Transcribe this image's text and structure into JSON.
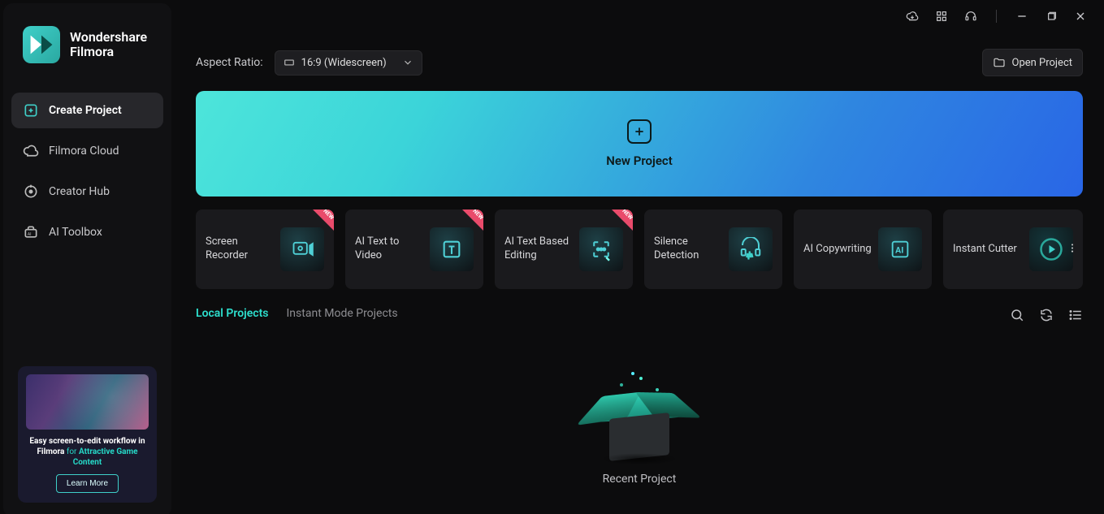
{
  "brand": {
    "line1": "Wondershare",
    "line2": "Filmora"
  },
  "sidebar": {
    "items": [
      {
        "label": "Create Project"
      },
      {
        "label": "Filmora Cloud"
      },
      {
        "label": "Creator Hub"
      },
      {
        "label": "AI Toolbox"
      }
    ]
  },
  "promo": {
    "brand": "Wondershare Filmora",
    "text_prefix": "Easy screen-to-edit workflow in Filmora ",
    "text_for": "for",
    "text_highlight": " Attractive Game Content",
    "button": "Learn More"
  },
  "topbar": {
    "aspect_label": "Aspect Ratio:",
    "aspect_value": "16:9 (Widescreen)",
    "open_project": "Open Project"
  },
  "hero": {
    "label": "New Project"
  },
  "tools": [
    {
      "label": "Screen Recorder",
      "new": true
    },
    {
      "label": "AI Text to Video",
      "new": true
    },
    {
      "label": "AI Text Based Editing",
      "new": true
    },
    {
      "label": "Silence Detection",
      "new": false
    },
    {
      "label": "AI Copywriting",
      "new": false
    },
    {
      "label": "Instant Cutter",
      "new": false
    }
  ],
  "new_badge_text": "NEW",
  "tabs": {
    "items": [
      {
        "label": "Local Projects"
      },
      {
        "label": "Instant Mode Projects"
      }
    ]
  },
  "empty": {
    "label": "Recent Project"
  }
}
